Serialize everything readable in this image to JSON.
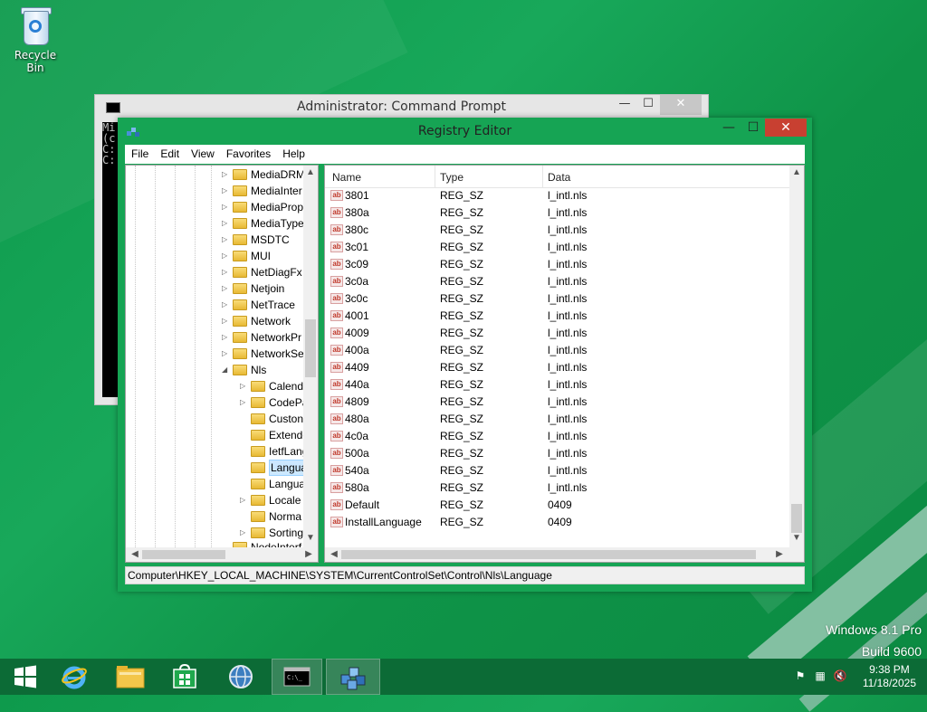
{
  "desktop": {
    "icons": [
      {
        "label": "Recycle Bin",
        "icon": "recycle-bin-icon"
      }
    ],
    "watermark": {
      "line1": "Windows 8.1 Pro",
      "line2": "Build 9600"
    }
  },
  "cmd_window": {
    "title": "Administrator: Command Prompt",
    "min_glyph": "—",
    "max_glyph": "☐",
    "close_glyph": "✕",
    "lines": [
      "Mi",
      "(c",
      "",
      "C:",
      "",
      "C:"
    ]
  },
  "regedit": {
    "title": "Registry Editor",
    "min_glyph": "—",
    "max_glyph": "☐",
    "close_glyph": "✕",
    "menu": [
      "File",
      "Edit",
      "View",
      "Favorites",
      "Help"
    ],
    "tree": {
      "parents": [
        {
          "label": "MediaDRM",
          "expander": "▷"
        },
        {
          "label": "MediaInter",
          "expander": "▷"
        },
        {
          "label": "MediaProp",
          "expander": "▷"
        },
        {
          "label": "MediaType",
          "expander": "▷"
        },
        {
          "label": "MSDTC",
          "expander": "▷"
        },
        {
          "label": "MUI",
          "expander": "▷"
        },
        {
          "label": "NetDiagFx",
          "expander": "▷"
        },
        {
          "label": "Netjoin",
          "expander": "▷"
        },
        {
          "label": "NetTrace",
          "expander": "▷"
        },
        {
          "label": "Network",
          "expander": "▷"
        },
        {
          "label": "NetworkPr",
          "expander": "▷"
        },
        {
          "label": "NetworkSe",
          "expander": "▷"
        },
        {
          "label": "Nls",
          "expander": "◢"
        }
      ],
      "children": [
        {
          "label": "Calend",
          "expander": "▷"
        },
        {
          "label": "CodePa",
          "expander": "▷"
        },
        {
          "label": "Custon",
          "expander": ""
        },
        {
          "label": "Extende",
          "expander": ""
        },
        {
          "label": "IetfLang",
          "expander": ""
        },
        {
          "label": "Langua",
          "expander": "",
          "selected": true
        },
        {
          "label": "Langua",
          "expander": ""
        },
        {
          "label": "Locale",
          "expander": "▷"
        },
        {
          "label": "Norma",
          "expander": ""
        },
        {
          "label": "Sorting",
          "expander": "▷"
        }
      ],
      "partial": "NodeInterf"
    },
    "columns": [
      "Name",
      "Type",
      "Data"
    ],
    "values": [
      {
        "name": "3801",
        "type": "REG_SZ",
        "data": "l_intl.nls"
      },
      {
        "name": "380a",
        "type": "REG_SZ",
        "data": "l_intl.nls"
      },
      {
        "name": "380c",
        "type": "REG_SZ",
        "data": "l_intl.nls"
      },
      {
        "name": "3c01",
        "type": "REG_SZ",
        "data": "l_intl.nls"
      },
      {
        "name": "3c09",
        "type": "REG_SZ",
        "data": "l_intl.nls"
      },
      {
        "name": "3c0a",
        "type": "REG_SZ",
        "data": "l_intl.nls"
      },
      {
        "name": "3c0c",
        "type": "REG_SZ",
        "data": "l_intl.nls"
      },
      {
        "name": "4001",
        "type": "REG_SZ",
        "data": "l_intl.nls"
      },
      {
        "name": "4009",
        "type": "REG_SZ",
        "data": "l_intl.nls"
      },
      {
        "name": "400a",
        "type": "REG_SZ",
        "data": "l_intl.nls"
      },
      {
        "name": "4409",
        "type": "REG_SZ",
        "data": "l_intl.nls"
      },
      {
        "name": "440a",
        "type": "REG_SZ",
        "data": "l_intl.nls"
      },
      {
        "name": "4809",
        "type": "REG_SZ",
        "data": "l_intl.nls"
      },
      {
        "name": "480a",
        "type": "REG_SZ",
        "data": "l_intl.nls"
      },
      {
        "name": "4c0a",
        "type": "REG_SZ",
        "data": "l_intl.nls"
      },
      {
        "name": "500a",
        "type": "REG_SZ",
        "data": "l_intl.nls"
      },
      {
        "name": "540a",
        "type": "REG_SZ",
        "data": "l_intl.nls"
      },
      {
        "name": "580a",
        "type": "REG_SZ",
        "data": "l_intl.nls"
      },
      {
        "name": "Default",
        "type": "REG_SZ",
        "data": "0409"
      },
      {
        "name": "InstallLanguage",
        "type": "REG_SZ",
        "data": "0409"
      }
    ],
    "value_icon_text": "ab",
    "status": "Computer\\HKEY_LOCAL_MACHINE\\SYSTEM\\CurrentControlSet\\Control\\Nls\\Language",
    "scroll": {
      "up": "▲",
      "down": "▼",
      "left": "◀",
      "right": "▶"
    }
  },
  "taskbar": {
    "buttons": [
      {
        "name": "start-button",
        "icon": "windows-logo-icon"
      },
      {
        "name": "internet-explorer-button",
        "icon": "internet-explorer-icon"
      },
      {
        "name": "file-explorer-button",
        "icon": "folder-icon"
      },
      {
        "name": "store-button",
        "icon": "store-icon"
      },
      {
        "name": "network-app-button",
        "icon": "globe-icon"
      },
      {
        "name": "command-prompt-button",
        "icon": "cmd-icon",
        "active": true
      },
      {
        "name": "registry-editor-button",
        "icon": "regedit-icon",
        "active": true
      }
    ],
    "tray": {
      "flag": "⚑",
      "network": "▦",
      "volume": "🔇"
    },
    "time": "9:38 PM",
    "date": "11/18/2025"
  },
  "colors": {
    "accent": "#16a454",
    "desktop": "#0f9a4c",
    "taskbar": "#0c6b36",
    "close": "#c84031",
    "selection": "#cce8ff"
  }
}
